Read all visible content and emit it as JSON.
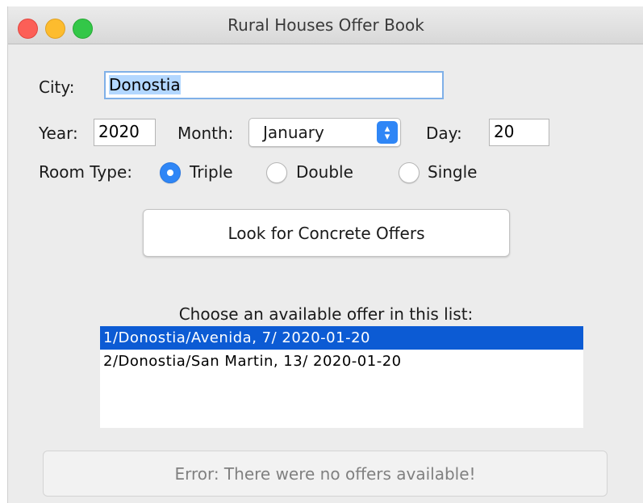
{
  "window": {
    "title": "Rural Houses Offer Book"
  },
  "form": {
    "city_label": "City:",
    "city_value": "Donostia",
    "year_label": "Year:",
    "year_value": "2020",
    "month_label": "Month:",
    "month_value": "January",
    "day_label": "Day:",
    "day_value": "20",
    "room_type_label": "Room Type:",
    "room_types": [
      {
        "label": "Triple",
        "selected": true
      },
      {
        "label": "Double",
        "selected": false
      },
      {
        "label": "Single",
        "selected": false
      }
    ]
  },
  "search_button": {
    "label": "Look for Concrete Offers"
  },
  "offers": {
    "caption": "Choose an available offer in this list:",
    "items": [
      {
        "text": "1/Donostia/Avenida, 7/ 2020-01-20",
        "selected": true
      },
      {
        "text": "2/Donostia/San Martin, 13/ 2020-01-20",
        "selected": false
      }
    ]
  },
  "status": {
    "error_text": "Error: There were no offers available!"
  },
  "colors": {
    "accent": "#2f86f6",
    "selection": "#0c5bd4",
    "text_highlight": "#b3d7ff"
  }
}
